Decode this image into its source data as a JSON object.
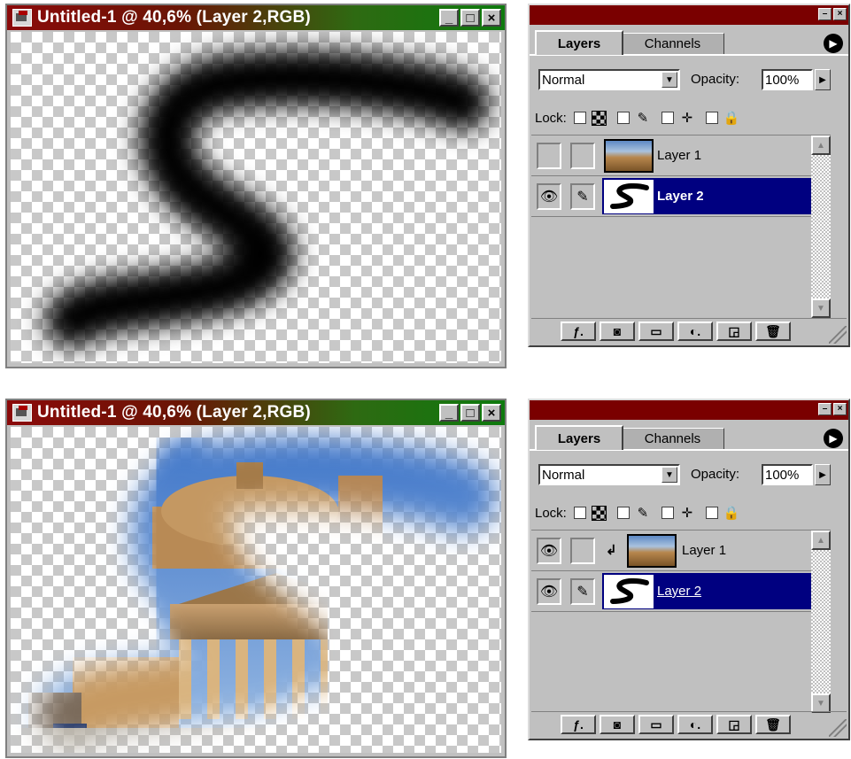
{
  "top": {
    "document": {
      "title": "Untitled-1 @ 40,6% (Layer 2,RGB)",
      "window_buttons": [
        "_",
        "□",
        "×"
      ]
    },
    "palette": {
      "tabs": [
        "Layers",
        "Channels"
      ],
      "blend_mode": "Normal",
      "opacity_label": "Opacity:",
      "opacity_value": "100%",
      "lock_label": "Lock:",
      "layers": [
        {
          "name": "Layer 1",
          "visible": false,
          "selected": false,
          "thumb": "mosta-rotunda-photo"
        },
        {
          "name": "Layer 2",
          "visible": true,
          "selected": true,
          "thumb": "black-s-brush-stroke"
        }
      ]
    }
  },
  "bottom": {
    "document": {
      "title": "Untitled-1 @ 40,6% (Layer 2,RGB)",
      "window_buttons": [
        "_",
        "□",
        "×"
      ]
    },
    "palette": {
      "tabs": [
        "Layers",
        "Channels"
      ],
      "blend_mode": "Normal",
      "opacity_label": "Opacity:",
      "opacity_value": "100%",
      "lock_label": "Lock:",
      "layers": [
        {
          "name": "Layer 1",
          "visible": true,
          "selected": false,
          "clipped": true,
          "thumb": "mosta-rotunda-photo"
        },
        {
          "name": "Layer 2",
          "visible": true,
          "selected": true,
          "thumb": "black-s-brush-stroke"
        }
      ]
    }
  },
  "icons": {
    "eye": "eye-icon",
    "brush": "brush-icon",
    "clip": "clipping-arrow-icon",
    "bottom_bar": [
      "layer-style-icon",
      "add-mask-icon",
      "new-set-icon",
      "adjustment-layer-icon",
      "new-layer-icon",
      "trash-icon"
    ]
  },
  "colors": {
    "doc_title_gradient": [
      "#8b0a0a",
      "#0d7a0d"
    ],
    "palette_title": "#7a0000",
    "selection": "#000080"
  }
}
